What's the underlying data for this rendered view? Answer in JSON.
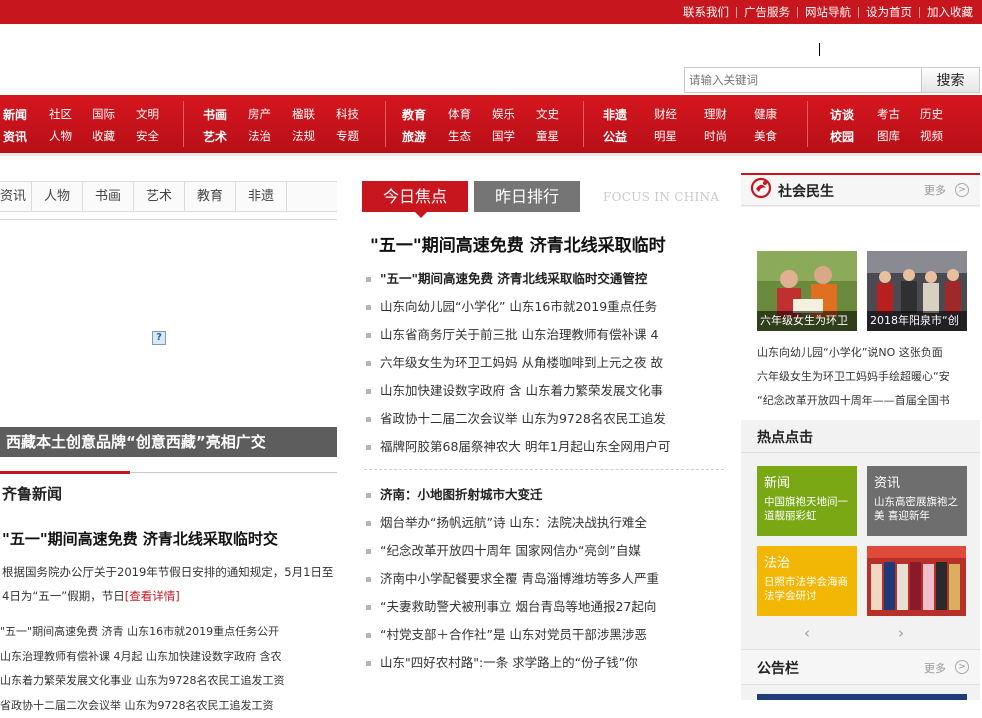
{
  "top_links": [
    "联系我们",
    "广告服务",
    "网站导航",
    "设为首页",
    "加入收藏"
  ],
  "search": {
    "placeholder": "请输入关键词",
    "button": "搜索"
  },
  "nav": {
    "group1": {
      "row1": [
        "新闻",
        "社区",
        "国际",
        "文明"
      ],
      "row2": [
        "资讯",
        "人物",
        "收藏",
        "安全"
      ]
    },
    "group2": {
      "row1": [
        "书画",
        "房产",
        "楹联",
        "科技"
      ],
      "row2": [
        "艺术",
        "法治",
        "法规",
        "专题"
      ]
    },
    "group3": {
      "row1": [
        "教育",
        "体育",
        "娱乐",
        "文史"
      ],
      "row2": [
        "旅游",
        "生态",
        "国学",
        "童星"
      ]
    },
    "group4": {
      "row1": [
        "非遗",
        "财经",
        "理财",
        "健康"
      ],
      "row2": [
        "公益",
        "明星",
        "时尚",
        "美食"
      ]
    },
    "group5": {
      "row1": [
        "访谈",
        "考古",
        "历史"
      ],
      "row2": [
        "校园",
        "图库",
        "视频"
      ]
    }
  },
  "left": {
    "tabs": [
      "资讯",
      "人物",
      "书画",
      "艺术",
      "教育",
      "非遗"
    ],
    "broken_image_glyph": "?",
    "slide_caption": "西藏本土创意品牌“创意西藏”亮相广交",
    "section_title": "齐鲁新闻",
    "headline": "\"五一\"期间高速免费 济青北线采取临时交",
    "summary": "根据国务院办公厅关于2019年节假日安排的通知规定，5月1日至4日为“五一”假期，节日",
    "summary_more": "[查看详情]",
    "list": [
      "\"五一\"期间高速免费  济青   山东16市就2019重点任务公开",
      "山东治理教师有偿补课 4月起  山东加快建设数字政府 含农",
      "山东着力繁荣发展文化事业  山东为9728名农民工追发工资",
      "省政协十二届二次会议举  山东为9728名农民工追发工资"
    ]
  },
  "center": {
    "tab_today": "今日焦点",
    "tab_yesterday": "昨日排行",
    "focus_label": "FOCUS IN CHINA",
    "headline": "\"五一\"期间高速免费 济青北线采取临时",
    "list1": [
      "\"五一\"期间高速免费  济青北线采取临时交通管控",
      "山东向幼儿园“小学化”   山东16市就2019重点任务",
      "山东省商务厅关于前三批  山东治理教师有偿补课 4",
      "六年级女生为环卫工妈妈  从角楼咖啡到上元之夜  故",
      "山东加快建设数字政府 含  山东着力繁荣发展文化事",
      "省政协十二届二次会议举  山东为9728名农民工追发",
      "福牌阿胶第68届祭神农大  明年1月起山东全网用户可"
    ],
    "list2": [
      "济南：小地图折射城市大变迁",
      "烟台举办“扬帆远航”诗  山东：法院决战执行难全",
      "“纪念改革开放四十周年  国家网信办“亮剑”自媒",
      "济南中小学配餐要求全覆  青岛淄博潍坊等多人严重",
      "“夫妻救助警犬被刑事立  烟台青岛等地通报27起向",
      "“村党支部＋合作社”是  山东对党员干部涉黑涉恶",
      "山东\"四好农村路\":一条  求学路上的“份子钱”你"
    ]
  },
  "right": {
    "title": "社会民生",
    "more": "更多",
    "photos": [
      "六年级女生为环卫",
      "2018年阳泉市“创"
    ],
    "list": [
      "山东向幼儿园“小学化”说NO 这张负面",
      "六年级女生为环卫工妈妈手绘超暖心“安",
      "“纪念改革开放四十周年——首届全国书"
    ],
    "hot_title": "热点点击",
    "tiles": [
      {
        "title": "新闻",
        "desc": "中国旗袍天地间一道靓丽彩虹",
        "color": "#7aa815"
      },
      {
        "title": "资讯",
        "desc": "山东高密展旗袍之美 喜迎新年",
        "color": "#6e6e6e"
      },
      {
        "title": "法治",
        "desc": "日照市法学会海商法学会研讨",
        "color": "#f2b705"
      }
    ],
    "prev": "‹",
    "next": "›",
    "notice_title": "公告栏",
    "notice_more": "更多"
  }
}
